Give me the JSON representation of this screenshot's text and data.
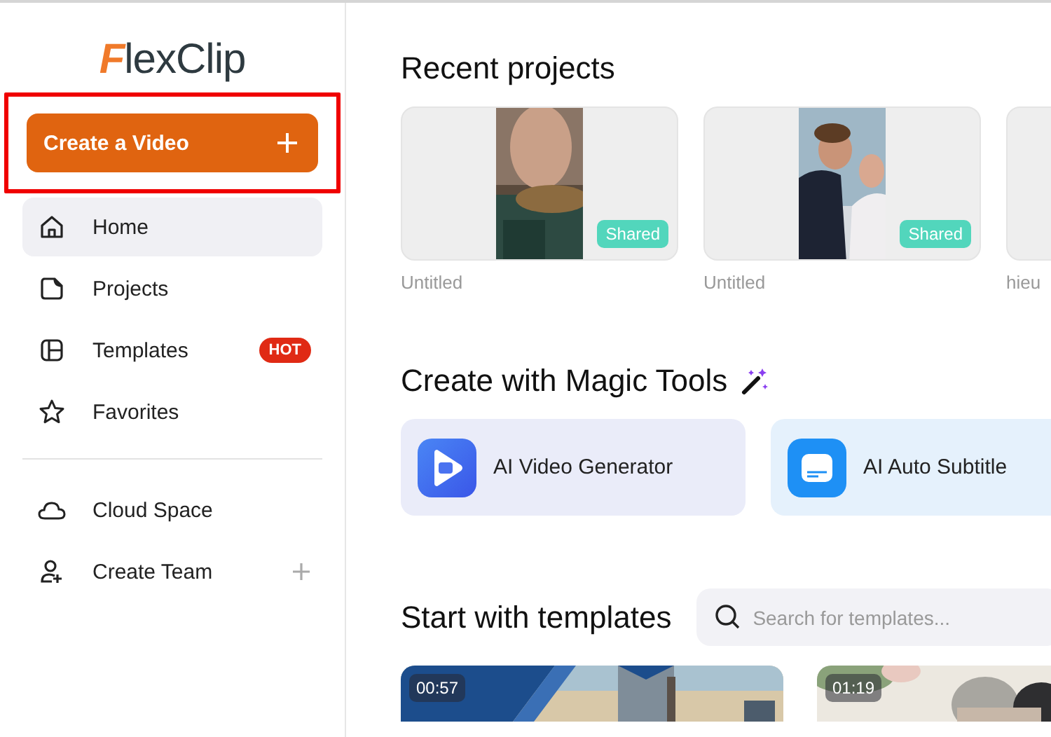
{
  "sidebar": {
    "logo": {
      "mark": "F",
      "text": "lexClip"
    },
    "create_button": {
      "label": "Create a Video",
      "highlighted": true
    },
    "items": [
      {
        "label": "Home",
        "selected": true
      },
      {
        "label": "Projects",
        "selected": false
      },
      {
        "label": "Templates",
        "selected": false,
        "badge": "HOT"
      },
      {
        "label": "Favorites",
        "selected": false
      }
    ],
    "extra_items": [
      {
        "label": "Cloud Space",
        "add": false
      },
      {
        "label": "Create Team",
        "add": true
      }
    ]
  },
  "recent_projects": {
    "title": "Recent projects",
    "items": [
      {
        "name": "Untitled",
        "badge": "Shared",
        "kind": "picture"
      },
      {
        "name": "Untitled",
        "badge": "Shared",
        "kind": "picture"
      },
      {
        "name": "hieu"
      }
    ]
  },
  "magic_tools": {
    "title": "Create with Magic Tools",
    "items": [
      {
        "label": "AI Video Generator",
        "kind": "generator"
      },
      {
        "label": "AI Auto Subtitle",
        "kind": "subtitle"
      }
    ]
  },
  "templates": {
    "title": "Start with templates",
    "search": {
      "placeholder": "Search for templates..."
    },
    "items": [
      {
        "duration": "00:57",
        "kind": "picture"
      },
      {
        "duration": "01:19",
        "kind": "picture"
      }
    ]
  }
}
